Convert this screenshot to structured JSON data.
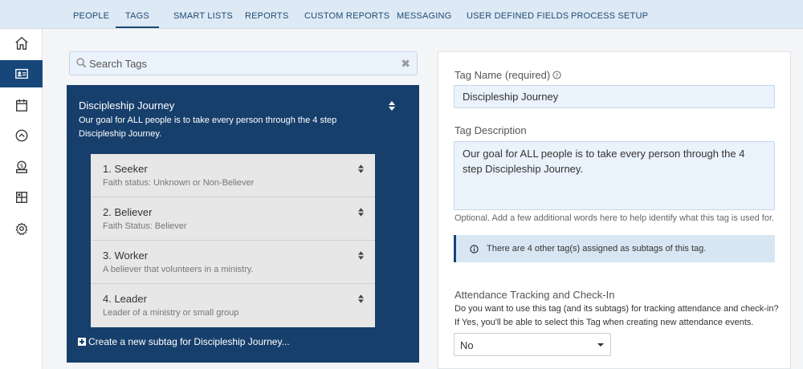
{
  "nav": {
    "tabs": [
      "PEOPLE",
      "TAGS",
      "SMART LISTS",
      "REPORTS",
      "CUSTOM REPORTS",
      "MESSAGING",
      "USER DEFINED FIELDS",
      "PROCESS SETUP"
    ],
    "active": "TAGS"
  },
  "sidebar": {
    "icons": [
      "home-icon",
      "contact-card-icon",
      "calendar-icon",
      "chevron-up-circle-icon",
      "money-icon",
      "grid-icon",
      "gear-icon"
    ],
    "active": "contact-card-icon"
  },
  "search": {
    "placeholder": "Search Tags",
    "clear": "✖"
  },
  "tag": {
    "title": "Discipleship Journey",
    "description": "Our goal for ALL people is to take every person through the 4 step Discipleship Journey.",
    "subtags": [
      {
        "name": "1. Seeker",
        "desc": "Faith status: Unknown or Non-Believer"
      },
      {
        "name": "2. Believer",
        "desc": "Faith Status: Believer"
      },
      {
        "name": "3. Worker",
        "desc": "A believer that volunteers in a ministry."
      },
      {
        "name": "4. Leader",
        "desc": "Leader of a ministry or small group"
      }
    ],
    "create_label": "Create a new subtag for Discipleship Journey..."
  },
  "form": {
    "name_label": "Tag Name (required)",
    "name_value": "Discipleship Journey",
    "desc_label": "Tag Description",
    "desc_value": "Our goal for ALL people is to take every person through the 4 step Discipleship Journey.",
    "desc_hint": "Optional. Add a few additional words here to help identify what this tag is used for.",
    "info_text": "There are 4 other tag(s) assigned as subtags of this tag.",
    "attendance_label": "Attendance Tracking and Check-In",
    "attendance_q1": "Do you want to use this tag (and its subtags) for tracking attendance and check-in?",
    "attendance_q2": "If Yes, you'll be able to select this Tag when creating new attendance events.",
    "attendance_value": "No"
  },
  "colors": {
    "navy": "#16467a",
    "nav_bg": "#dde9f5",
    "field_bg": "#eaf2fb"
  }
}
